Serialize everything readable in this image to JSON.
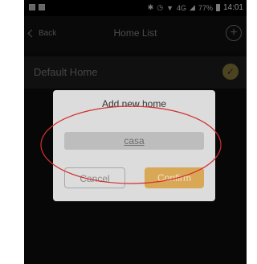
{
  "statusbar": {
    "signal_text": "4G",
    "battery_percent": "77%",
    "time": "14:01"
  },
  "header": {
    "back_label": "Back",
    "title": "Home List"
  },
  "home_list": [
    {
      "name": "Default Home",
      "selected": true
    }
  ],
  "dialog": {
    "title": "Add new home",
    "input_value": "casa",
    "cancel_label": "Cancel",
    "confirm_label": "Confirm"
  },
  "colors": {
    "accent": "#d9a857",
    "check": "#8b7a3c",
    "annotation": "#d32f2f"
  }
}
